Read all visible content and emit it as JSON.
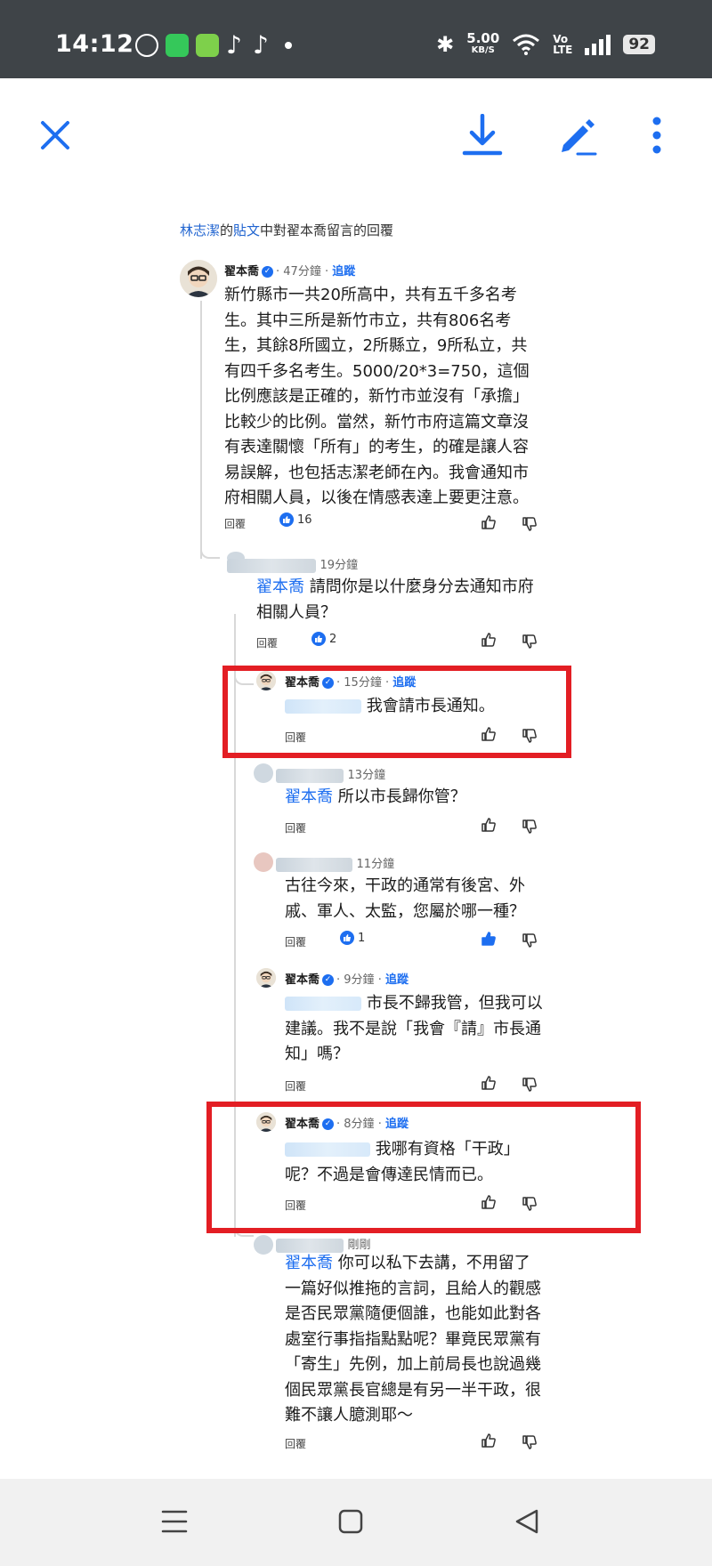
{
  "status_bar": {
    "time": "14:12",
    "speed_value": "5.00",
    "speed_unit": "KB/S",
    "volte_top": "Vo",
    "volte_bottom": "LTE",
    "battery": "92"
  },
  "toolbar": {
    "close_icon": "close-icon",
    "download_icon": "download-icon",
    "edit_icon": "edit-pen-icon",
    "more_icon": "more-vertical-icon"
  },
  "source": {
    "author": "林志潔",
    "de": "的",
    "post": "貼文",
    "rest": "中對翟本喬留言的回覆"
  },
  "labels": {
    "reply": "回覆",
    "follow": "追蹤"
  },
  "comments": [
    {
      "name": "翟本喬",
      "time": "47分鐘",
      "body": "新竹縣市一共20所高中，共有五千多名考生。其中三所是新竹市立，共有806名考生，其餘8所國立，2所縣立，9所私立，共有四千多名考生。5000/20*3=750，這個比例應該是正確的，新竹市並沒有「承擔」比較少的比例。當然，新竹市府這篇文章沒有表達關懷「所有」的考生，的確是讓人容易誤解，也包括志潔老師在內。我會通知市府相關人員，以後在情感表達上要更注意。",
      "likes": "16"
    },
    {
      "time": "19分鐘",
      "mention": "翟本喬",
      "body": " 請問你是以什麼身分去通知市府相關人員？",
      "likes": "2"
    },
    {
      "name": "翟本喬",
      "time": "15分鐘",
      "body": "我會請市長通知。"
    },
    {
      "time": "13分鐘",
      "mention": "翟本喬",
      "body": " 所以市長歸你管？"
    },
    {
      "time": "11分鐘",
      "body": "古往今來，干政的通常有後宮、外戚、軍人、太監，您屬於哪一種？",
      "likes": "1"
    },
    {
      "name": "翟本喬",
      "time": "9分鐘",
      "body_line1": "市長不歸我管，但我可以",
      "body_rest": "建議。我不是說「我會『請』市長通知」嗎？"
    },
    {
      "name": "翟本喬",
      "time": "8分鐘",
      "body_line1": "我哪有資格「干政」",
      "body_rest": "呢？不過是會傳達民情而已。"
    },
    {
      "time": "剛剛",
      "mention": "翟本喬",
      "body": " 你可以私下去講，不用留了一篇好似推拖的言詞，且給人的觀感是否民眾黨隨便個誰，也能如此對各處室行事指指點點呢？畢竟民眾黨有「寄生」先例，加上前局長也說過幾個民眾黨長官總是有另一半干政，很難不讓人臆測耶～"
    }
  ],
  "nav": {
    "menu_icon": "menu-icon",
    "home_icon": "home-square-icon",
    "back_icon": "back-triangle-icon"
  },
  "colors": {
    "accent": "#1d6ef0",
    "highlight": "#e31e24",
    "status_bar": "#3f4448"
  }
}
